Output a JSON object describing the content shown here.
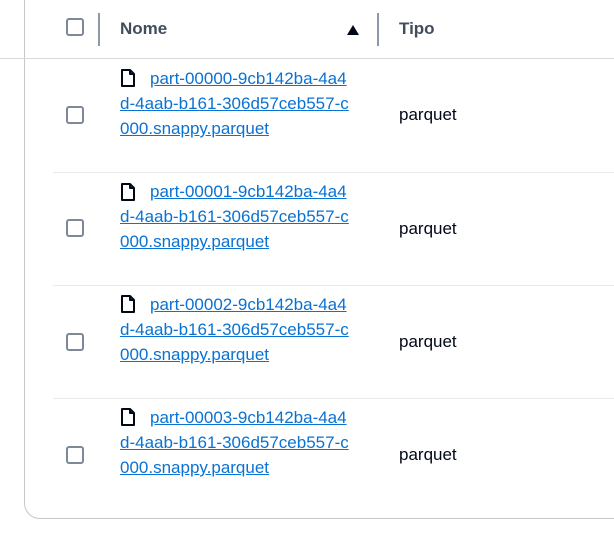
{
  "table": {
    "columns": {
      "name": "Nome",
      "type": "Tipo"
    },
    "rows": [
      {
        "name": "part-00000-9cb142ba-4a4d-4aab-b161-306d57ceb557-c000.snappy.parquet",
        "type": "parquet",
        "icon": "file-icon"
      },
      {
        "name": "part-00001-9cb142ba-4a4d-4aab-b161-306d57ceb557-c000.snappy.parquet",
        "type": "parquet",
        "icon": "file-icon"
      },
      {
        "name": "part-00002-9cb142ba-4a4d-4aab-b161-306d57ceb557-c000.snappy.parquet",
        "type": "parquet",
        "icon": "file-icon"
      },
      {
        "name": "part-00003-9cb142ba-4a4d-4aab-b161-306d57ceb557-c000.snappy.parquet",
        "type": "parquet",
        "icon": "file-icon"
      }
    ],
    "sort": {
      "column": "name",
      "direction": "ascending",
      "icon": "sort-ascending-icon"
    }
  },
  "colors": {
    "link": "#0972d3",
    "checkbox_border": "#7d8998",
    "header_text": "#414d5c"
  }
}
